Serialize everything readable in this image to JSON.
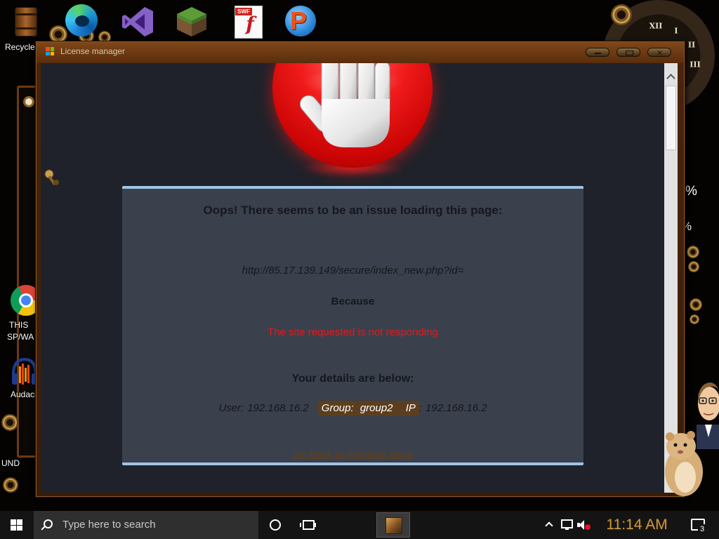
{
  "desktop": {
    "recycle_label": "Recycle",
    "swf_badge": "SWF",
    "swf_logo_letter": "f",
    "p_icon_letter": "P",
    "chrome_label_line1": "THIS",
    "chrome_label_line2": "SP/WA",
    "audacity_label": "Audaci",
    "und_label": "UND",
    "widget_percent_1": "%",
    "widget_percent_2": "%",
    "clock_numerals": [
      "XII",
      "I",
      "II",
      "III"
    ],
    "icons": [
      "recycle-bin-icon",
      "edge-icon",
      "visual-studio-icon",
      "minecraft-icon",
      "flash-swf-icon",
      "pale-moon-icon",
      "chrome-icon",
      "audacity-icon"
    ]
  },
  "window": {
    "title": "License manager",
    "title_icon": "app-icon",
    "controls": [
      "minimize-icon",
      "maximize-icon",
      "close-icon"
    ]
  },
  "error_page": {
    "icon": "stop-hand-icon",
    "heading": "Oops! There seems to be an issue loading this page:",
    "url": "http://85.17.139.149/secure/index_new.php?id=",
    "because_label": "Because",
    "reason": "The site requested is not responding",
    "details_heading": "Your details are below:",
    "user_label": "User:",
    "user_value": "192.168.16.2",
    "group_label": "Group:",
    "group_value": "group2",
    "ip_label": "IP",
    "ip_separator": ":",
    "ip_value": "192.168.16.2",
    "back_link": "Go back to previous page"
  },
  "taskbar": {
    "search_placeholder": "Type here to search",
    "time": "11:14 AM",
    "notification_count": "3",
    "icons": [
      "windows-start-icon",
      "search-icon",
      "cortana-icon",
      "task-view-icon",
      "chevron-up-icon",
      "network-icon",
      "volume-muted-icon",
      "notification-icon"
    ]
  },
  "colors": {
    "page_bg": "#1f222a",
    "panel_bg": "#3b404d",
    "panel_border": "#9fc4e7",
    "reason_text": "#e3191b",
    "link_text": "#5e411c",
    "highlight_bg": "#5c3e1e",
    "clock_gold": "#c99a3e",
    "title_text": "#d9c8a4"
  }
}
